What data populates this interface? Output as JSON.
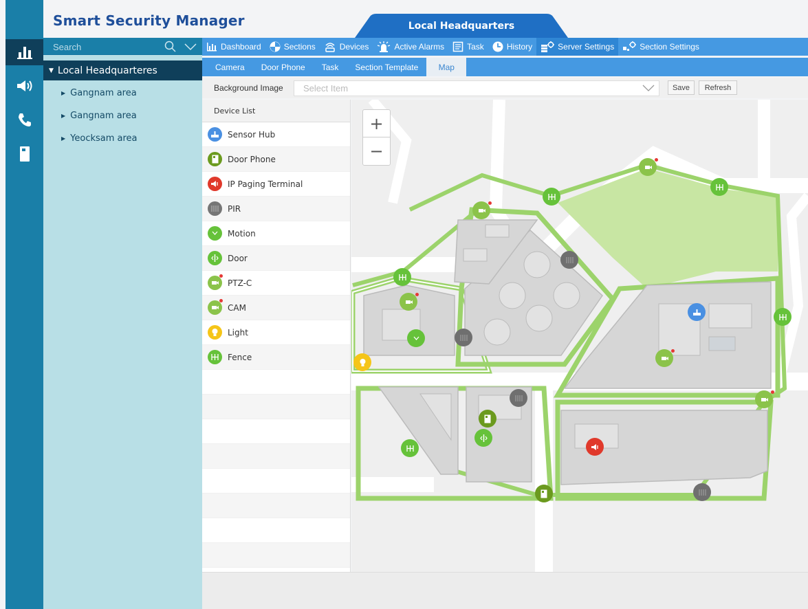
{
  "app": {
    "title": "Smart Security Manager"
  },
  "header": {
    "active_site": "Local Headquarters"
  },
  "search": {
    "placeholder": "Search"
  },
  "tree": {
    "root": "Local Headquarteres",
    "children": [
      "Gangnam area",
      "Gangnam area",
      "Yeocksam area"
    ]
  },
  "nav": {
    "items": [
      "Dashboard",
      "Sections",
      "Devices",
      "Active Alarms",
      "Task",
      "History",
      "Server Settings",
      "Section Settings"
    ],
    "active": "Server Settings"
  },
  "subnav": {
    "items": [
      "Camera",
      "Door Phone",
      "Task",
      "Section Template",
      "Map"
    ],
    "active": "Map"
  },
  "toolbar": {
    "background_label": "Background Image",
    "select_placeholder": "Select Item",
    "save_label": "Save",
    "refresh_label": "Refresh"
  },
  "device_list": {
    "header": "Device List",
    "items": [
      {
        "label": "Sensor Hub",
        "color": "#4a90e2",
        "icon": "sensor-hub-icon"
      },
      {
        "label": "Door Phone",
        "color": "#6b9a1e",
        "icon": "door-phone-icon"
      },
      {
        "label": "IP Paging Terminal",
        "color": "#e0392b",
        "icon": "speaker-icon"
      },
      {
        "label": "PIR",
        "color": "#757575",
        "icon": "pir-icon"
      },
      {
        "label": "Motion",
        "color": "#66c23a",
        "icon": "motion-icon"
      },
      {
        "label": "Door",
        "color": "#66c23a",
        "icon": "door-icon"
      },
      {
        "label": "PTZ-C",
        "color": "#8bc34a",
        "icon": "ptz-camera-icon"
      },
      {
        "label": "CAM",
        "color": "#8bc34a",
        "icon": "camera-icon"
      },
      {
        "label": "Light",
        "color": "#f5c518",
        "icon": "light-icon"
      },
      {
        "label": "Fence",
        "color": "#66c23a",
        "icon": "fence-icon"
      }
    ]
  },
  "map": {
    "zoom_in": "+",
    "zoom_out": "−"
  },
  "colors": {
    "brand_dark": "#0f3f5a",
    "brand": "#1a7fa8",
    "nav_blue": "#4599e2",
    "tab_blue": "#1f6fc4",
    "green": "#66c23a"
  }
}
